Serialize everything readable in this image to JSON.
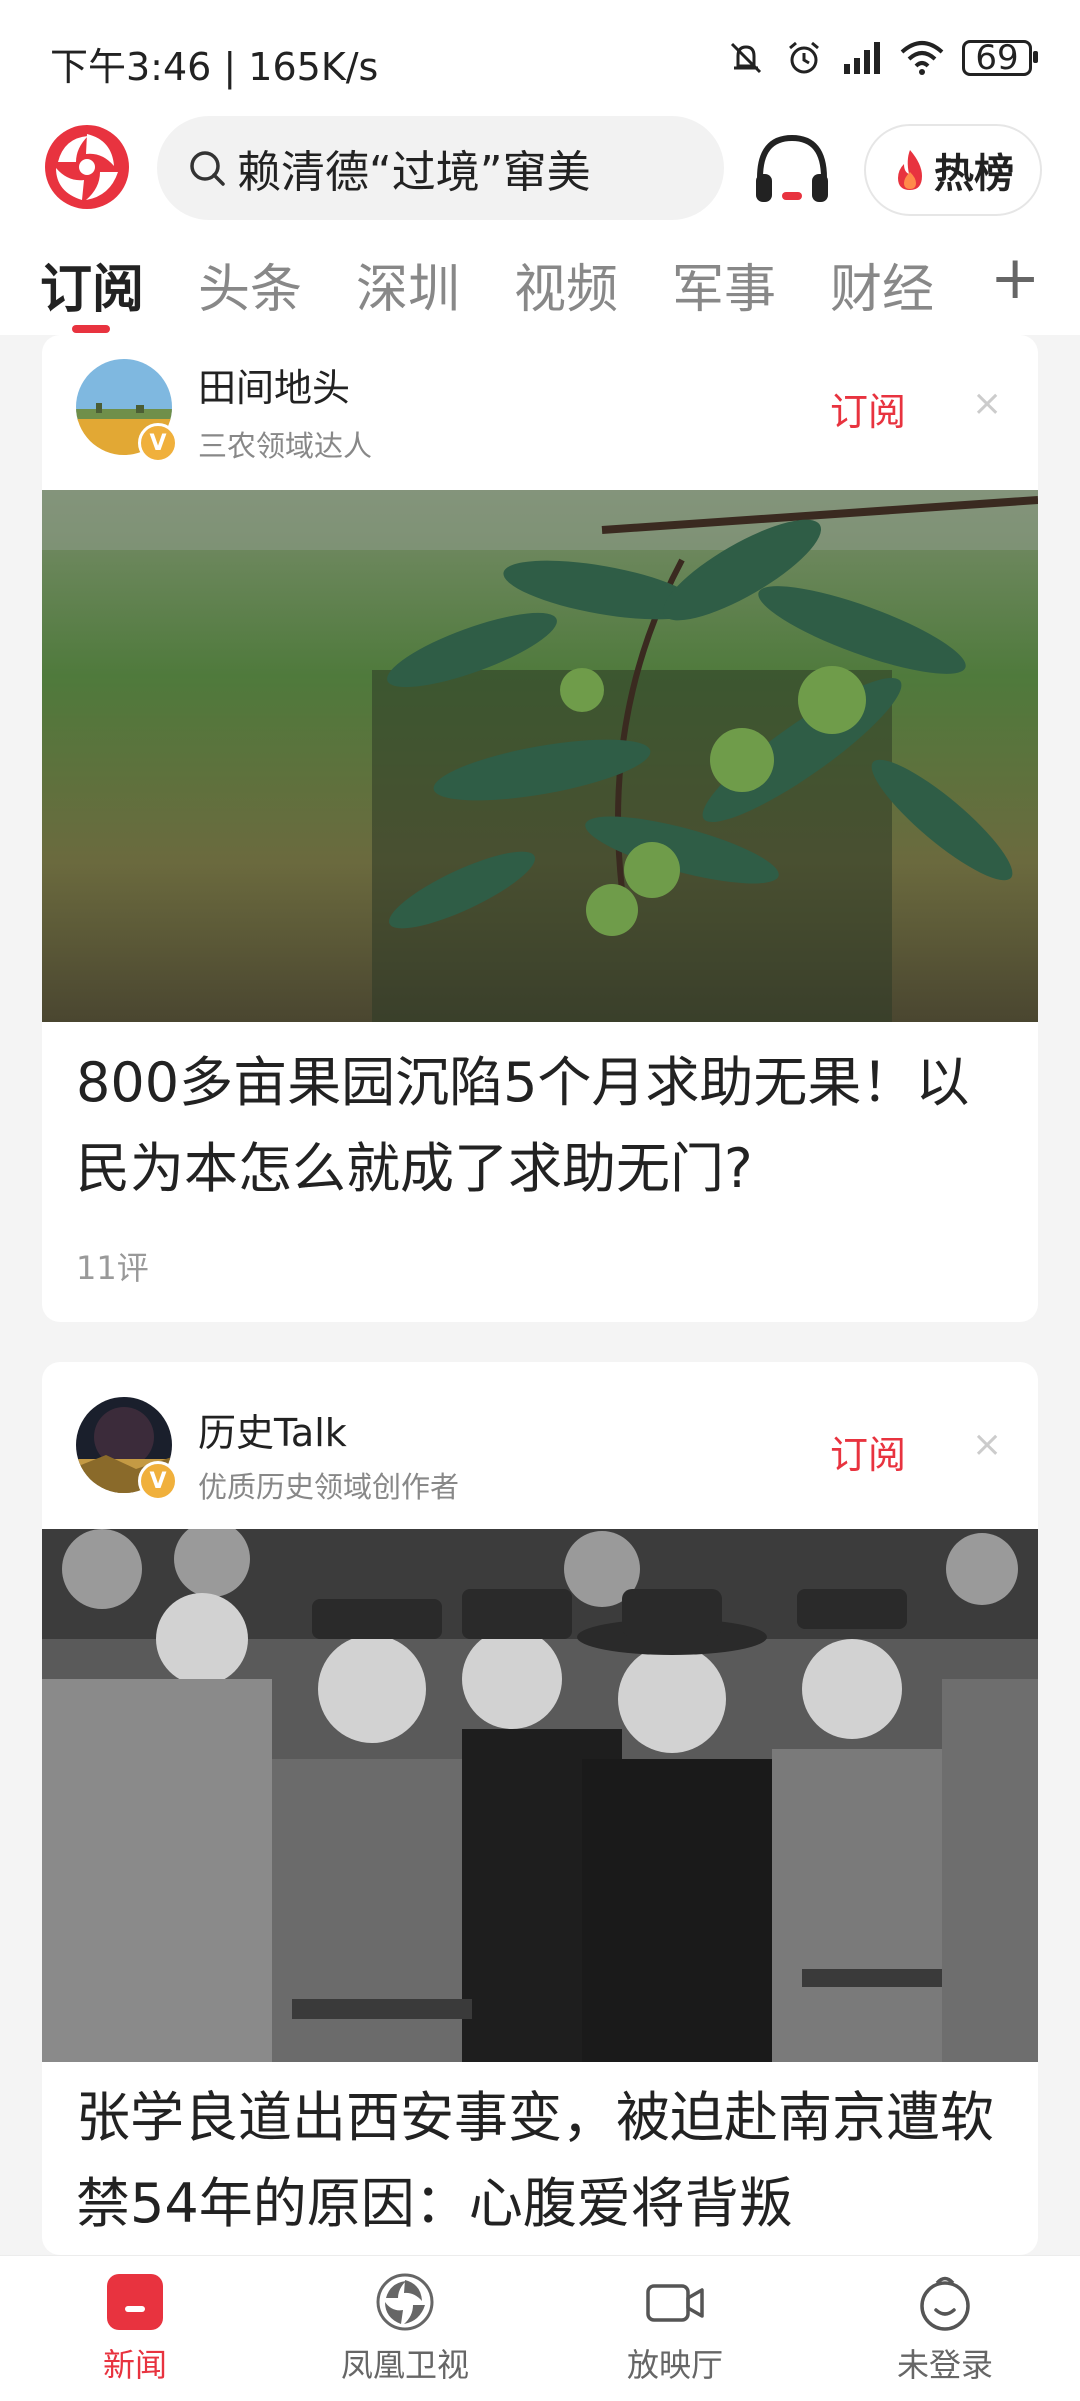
{
  "status_bar": {
    "time": "下午3:46 | 165K/s",
    "battery": "69",
    "icons": [
      "mute-icon",
      "alarm-icon",
      "signal-icon",
      "wifi-icon",
      "battery-icon"
    ]
  },
  "header": {
    "search_query": "赖清德“过境”窜美",
    "hot_label": "热榜"
  },
  "tabs": [
    {
      "label": "订阅",
      "active": true
    },
    {
      "label": "头条"
    },
    {
      "label": "深圳"
    },
    {
      "label": "视频"
    },
    {
      "label": "军事"
    },
    {
      "label": "财经"
    }
  ],
  "tab_add": "+",
  "feed": [
    {
      "author": "田间地头",
      "author_desc": "三农领域达人",
      "subscribe_label": "订阅",
      "close": "×",
      "verified": "V",
      "title": "800多亩果园沉陷5个月求助无果！以民为本怎么就成了求助无门?",
      "meta": "11评"
    },
    {
      "author": "历史Talk",
      "author_desc": "优质历史领域创作者",
      "subscribe_label": "订阅",
      "close": "×",
      "verified": "V",
      "title": "张学良道出西安事变，被迫赴南京遭软禁54年的原因：心腹爱将背叛"
    }
  ],
  "bottom_nav": [
    {
      "label": "新闻",
      "active": true
    },
    {
      "label": "凤凰卫视"
    },
    {
      "label": "放映厅"
    },
    {
      "label": "未登录"
    }
  ],
  "colors": {
    "accent": "#e8333f",
    "badge": "#f0b03c",
    "text": "#222222",
    "muted": "#888888"
  }
}
